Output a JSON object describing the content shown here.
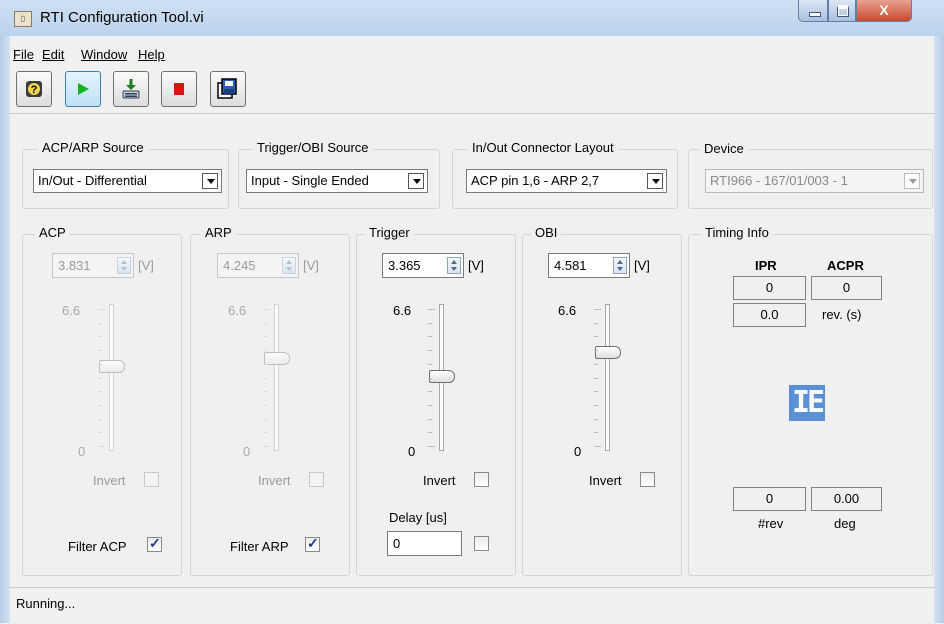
{
  "window": {
    "title": "RTI Configuration Tool.vi",
    "close_glyph": "X"
  },
  "menu": {
    "file": "File",
    "edit": "Edit",
    "window": "Window",
    "help": "Help"
  },
  "toolbar": [
    "help-icon",
    "run-icon",
    "download-icon",
    "stop-icon",
    "save-icon"
  ],
  "sources": {
    "acp_arp": {
      "label": "ACP/ARP Source",
      "value": "In/Out - Differential"
    },
    "trigger_obi": {
      "label": "Trigger/OBI Source",
      "value": "Input - Single Ended"
    },
    "connector": {
      "label": "In/Out Connector Layout",
      "value": "ACP pin 1,6 - ARP 2,7"
    },
    "device": {
      "label": "Device",
      "value": "RTI966 - 167/01/003 - 1"
    }
  },
  "channels": {
    "acp": {
      "label": "ACP",
      "value": "3.831",
      "unit": "[V]",
      "max": "6.6",
      "min": "0",
      "level": 0.58,
      "invert": "Invert",
      "filter": "Filter ACP"
    },
    "arp": {
      "label": "ARP",
      "value": "4.245",
      "unit": "[V]",
      "max": "6.6",
      "min": "0",
      "level": 0.64,
      "invert": "Invert",
      "filter": "Filter ARP"
    },
    "trigger": {
      "label": "Trigger",
      "value": "3.365",
      "unit": "[V]",
      "max": "6.6",
      "min": "0",
      "level": 0.51,
      "invert": "Invert",
      "delay_label": "Delay [us]",
      "delay_value": "0"
    },
    "obi": {
      "label": "OBI",
      "value": "4.581",
      "unit": "[V]",
      "max": "6.6",
      "min": "0",
      "level": 0.69,
      "invert": "Invert"
    }
  },
  "timing": {
    "label": "Timing Info",
    "ipr_header": "IPR",
    "acpr_header": "ACPR",
    "ipr": "0",
    "acpr": "0",
    "ipr_time": "0.0",
    "rev_unit": "rev. (s)",
    "logo": "IE",
    "rev_count": "0",
    "deg": "0.00",
    "rev_count_label": "#rev",
    "deg_label": "deg"
  },
  "status": "Running..."
}
